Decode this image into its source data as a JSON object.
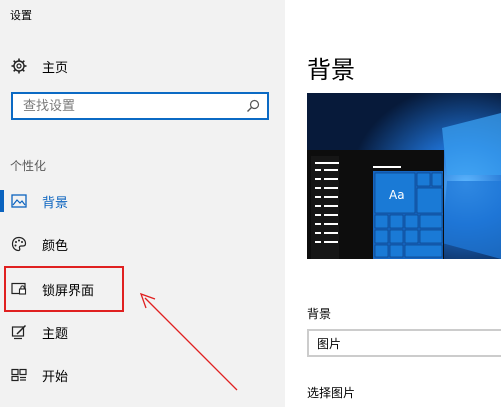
{
  "window": {
    "title": "设置"
  },
  "sidebar": {
    "home_label": "主页",
    "home_icon": "gear-icon",
    "search": {
      "placeholder": "查找设置",
      "value": ""
    },
    "section_title": "个性化",
    "items": [
      {
        "label": "背景",
        "icon": "picture-icon",
        "active": true
      },
      {
        "label": "颜色",
        "icon": "palette-icon",
        "active": false
      },
      {
        "label": "锁屏界面",
        "icon": "lock-screen-icon",
        "active": false
      },
      {
        "label": "主题",
        "icon": "theme-brush-icon",
        "active": false
      },
      {
        "label": "开始",
        "icon": "start-menu-icon",
        "active": false
      }
    ]
  },
  "main": {
    "title": "背景",
    "preview": {
      "tile_label": "Aa"
    },
    "background_label": "背景",
    "background_value": "图片",
    "choose_picture_label": "选择图片"
  },
  "colors": {
    "accent": "#0b63bf",
    "highlight": "#e02020",
    "sidebar_bg": "#f2f2f2"
  }
}
